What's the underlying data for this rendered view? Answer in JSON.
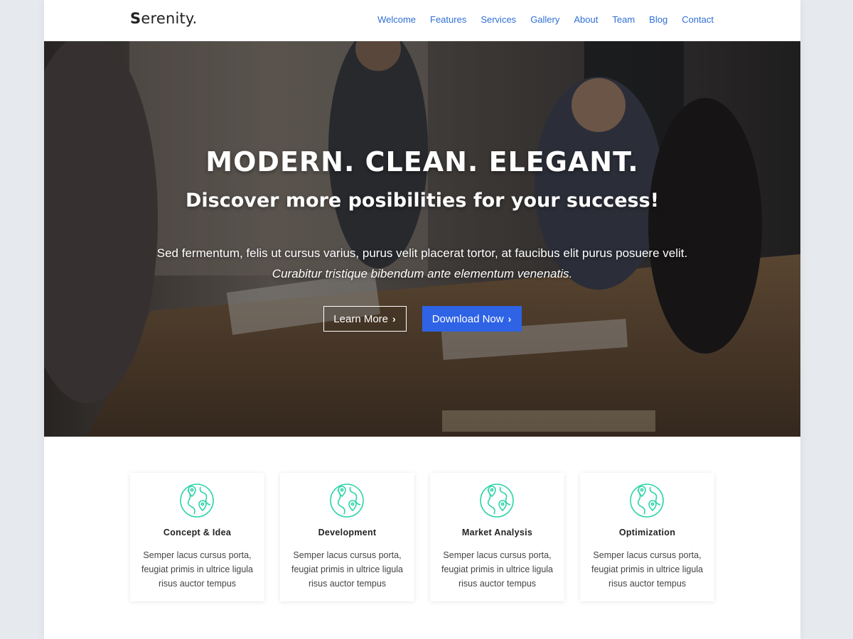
{
  "header": {
    "logo_first": "S",
    "logo_rest": "erenity.",
    "nav": [
      {
        "label": "Welcome"
      },
      {
        "label": "Features"
      },
      {
        "label": "Services"
      },
      {
        "label": "Gallery"
      },
      {
        "label": "About"
      },
      {
        "label": "Team"
      },
      {
        "label": "Blog"
      },
      {
        "label": "Contact"
      }
    ]
  },
  "hero": {
    "title": "MODERN. CLEAN. ELEGANT.",
    "subtitle": "Discover more posibilities for your success!",
    "text": "Sed fermentum, felis ut cursus varius, purus velit placerat tortor, at faucibus elit purus posuere velit.",
    "text_italic": "Curabitur tristique bibendum ante elementum venenatis.",
    "learn_more": "Learn More",
    "download_now": "Download Now"
  },
  "features": [
    {
      "title": "Concept & Idea",
      "text": "Semper lacus cursus porta, feugiat primis in ultrice ligula risus auctor tempus"
    },
    {
      "title": "Development",
      "text": "Semper lacus cursus porta, feugiat primis in ultrice ligula risus auctor tempus"
    },
    {
      "title": "Market Analysis",
      "text": "Semper lacus cursus porta, feugiat primis in ultrice ligula risus auctor tempus"
    },
    {
      "title": "Optimization",
      "text": "Semper lacus cursus porta, feugiat primis in ultrice ligula risus auctor tempus"
    }
  ],
  "icons": {
    "feature_icon": "globe-pin-icon",
    "chevron": "chevron-right-icon"
  },
  "colors": {
    "accent": "#2f63e6",
    "nav_link": "#2f6fd6",
    "icon": "#2dd4a8"
  }
}
